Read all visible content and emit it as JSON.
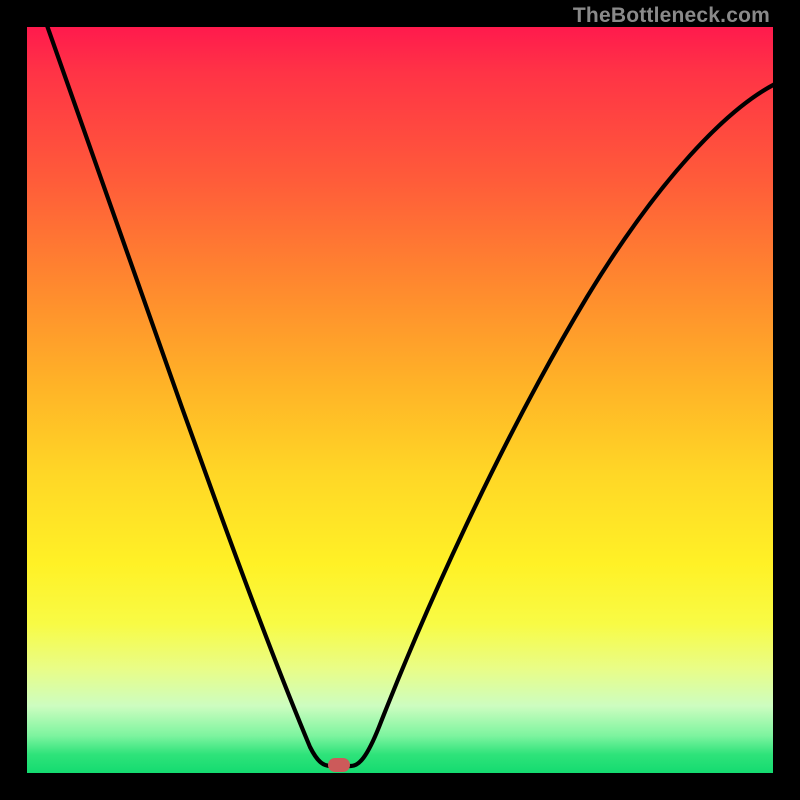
{
  "watermark": "TheBottleneck.com",
  "colors": {
    "frame": "#000000",
    "curve": "#000000",
    "marker": "#cc5a5a",
    "gradient_top": "#ff1a4d",
    "gradient_bottom": "#14db70"
  },
  "chart_data": {
    "type": "line",
    "title": "",
    "xlabel": "",
    "ylabel": "",
    "xlim": [
      0,
      100
    ],
    "ylim": [
      0,
      100
    ],
    "series": [
      {
        "name": "bottleneck-curve",
        "x": [
          2,
          5,
          10,
          15,
          20,
          25,
          30,
          35,
          38,
          40,
          41.5,
          42.5,
          44,
          48,
          55,
          62,
          70,
          78,
          86,
          94,
          100
        ],
        "values": [
          100,
          91,
          77,
          64,
          52,
          40,
          29,
          18,
          10,
          4,
          1,
          1,
          3,
          12,
          27,
          41,
          55,
          67,
          77,
          86,
          92
        ]
      }
    ],
    "annotations": [
      {
        "name": "marker",
        "x": 42,
        "y": 1,
        "color": "#cc5a5a"
      }
    ]
  }
}
